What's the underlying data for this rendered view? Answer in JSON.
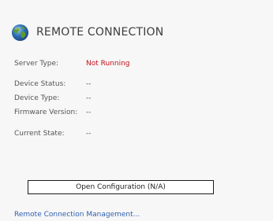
{
  "header": {
    "title": "REMOTE CONNECTION",
    "icon": "globe-icon",
    "icon_colors": {
      "ocean": "#2f6fb3",
      "land": "#5e9a2c",
      "highlight": "#8cc6f0"
    }
  },
  "fields": [
    {
      "label": "Server Type:",
      "value": "Not Running",
      "status_color": "#c0101a"
    },
    {
      "label": "Device Status:",
      "value": "--"
    },
    {
      "label": "Device Type:",
      "value": "--"
    },
    {
      "label": "Firmware Version:",
      "value": "--"
    },
    {
      "label": "Current State:",
      "value": "--"
    }
  ],
  "actions": {
    "open_config_label": "Open Configuration (N/A)",
    "management_link": "Remote Connection Management..."
  },
  "colors": {
    "background": "#f7f7f7",
    "link": "#2f5fb0",
    "alert": "#c0101a"
  }
}
